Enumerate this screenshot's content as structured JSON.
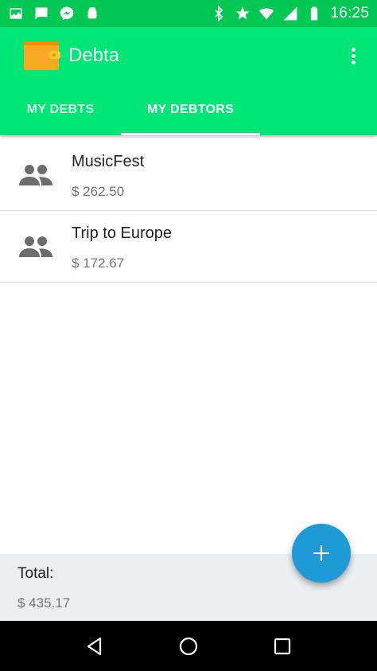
{
  "status_bar": {
    "time": "16:25",
    "left_icons": [
      "image-icon",
      "chat-icon",
      "messenger-icon",
      "android-icon"
    ],
    "right_icons": [
      "bluetooth-icon",
      "star-icon",
      "wifi-icon",
      "signal-icon",
      "battery-icon"
    ]
  },
  "app_bar": {
    "title": "Debta",
    "logo": "wallet-icon",
    "menu_icon": "more-vert-icon"
  },
  "tabs": [
    {
      "label": "MY DEBTS",
      "active": false
    },
    {
      "label": "MY DEBTORS",
      "active": true
    }
  ],
  "list": {
    "items": [
      {
        "title": "MusicFest",
        "amount": "$ 262.50",
        "icon": "group-icon"
      },
      {
        "title": "Trip to Europe",
        "amount": "$ 172.67",
        "icon": "group-icon"
      }
    ]
  },
  "footer": {
    "total_label": "Total:",
    "total_value": "$ 435.17"
  },
  "fab": {
    "icon": "add-icon"
  },
  "nav_bar": {
    "buttons": [
      "back-icon",
      "home-icon",
      "recents-icon"
    ]
  },
  "colors": {
    "status_bar": "#00c853",
    "app_bar": "#00e676",
    "fab": "#1e9ad6",
    "footer_bg": "#eceff1"
  }
}
